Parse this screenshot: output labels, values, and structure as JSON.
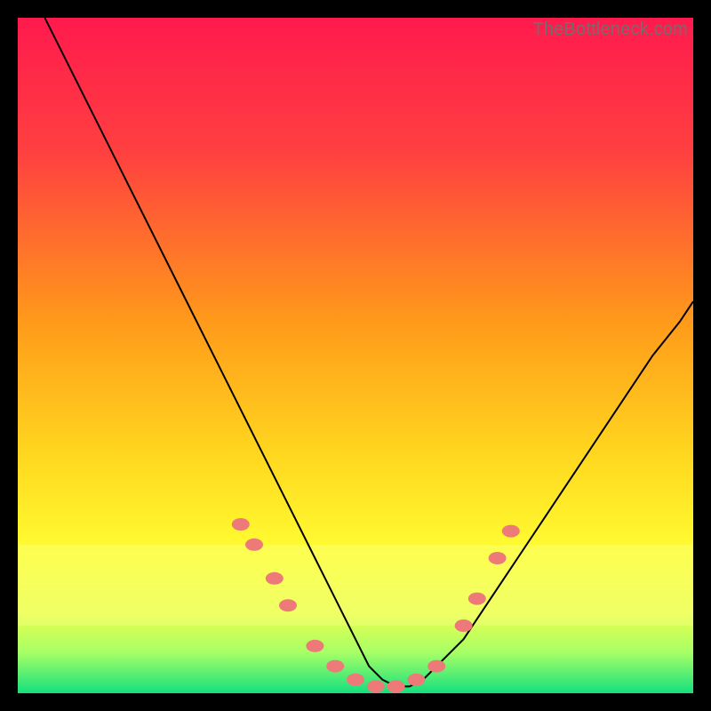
{
  "watermark": "TheBottleneck.com",
  "chart_data": {
    "type": "line",
    "title": "",
    "xlabel": "",
    "ylabel": "",
    "xlim": [
      0,
      100
    ],
    "ylim": [
      0,
      100
    ],
    "gradient_stops": [
      {
        "offset": 0,
        "color": "#ff1a4d"
      },
      {
        "offset": 20,
        "color": "#ff4040"
      },
      {
        "offset": 45,
        "color": "#ff9a1a"
      },
      {
        "offset": 65,
        "color": "#ffd81f"
      },
      {
        "offset": 80,
        "color": "#ffff33"
      },
      {
        "offset": 88,
        "color": "#ecff4d"
      },
      {
        "offset": 94,
        "color": "#a6ff66"
      },
      {
        "offset": 100,
        "color": "#14e07e"
      }
    ],
    "highlight_bands": [
      {
        "y0": 78,
        "y1": 90,
        "color": "#f6ff8f",
        "opacity": 0.35
      }
    ],
    "series": [
      {
        "name": "curve",
        "stroke": "#000000",
        "stroke_width": 2,
        "x": [
          4,
          8,
          12,
          16,
          20,
          24,
          28,
          32,
          36,
          40,
          44,
          48,
          50,
          52,
          54,
          56,
          58,
          60,
          62,
          66,
          70,
          74,
          78,
          82,
          86,
          90,
          94,
          98,
          100
        ],
        "y": [
          100,
          92,
          84,
          76,
          68,
          60,
          52,
          44,
          36,
          28,
          20,
          12,
          8,
          4,
          2,
          1,
          1,
          2,
          4,
          8,
          14,
          20,
          26,
          32,
          38,
          44,
          50,
          55,
          58
        ]
      }
    ],
    "markers": {
      "color": "#ed7a78",
      "rx": 10,
      "ry": 7,
      "points": [
        {
          "x": 33,
          "y": 25
        },
        {
          "x": 35,
          "y": 22
        },
        {
          "x": 38,
          "y": 17
        },
        {
          "x": 40,
          "y": 13
        },
        {
          "x": 44,
          "y": 7
        },
        {
          "x": 47,
          "y": 4
        },
        {
          "x": 50,
          "y": 2
        },
        {
          "x": 53,
          "y": 1
        },
        {
          "x": 56,
          "y": 1
        },
        {
          "x": 59,
          "y": 2
        },
        {
          "x": 62,
          "y": 4
        },
        {
          "x": 66,
          "y": 10
        },
        {
          "x": 68,
          "y": 14
        },
        {
          "x": 71,
          "y": 20
        },
        {
          "x": 73,
          "y": 24
        }
      ]
    }
  }
}
